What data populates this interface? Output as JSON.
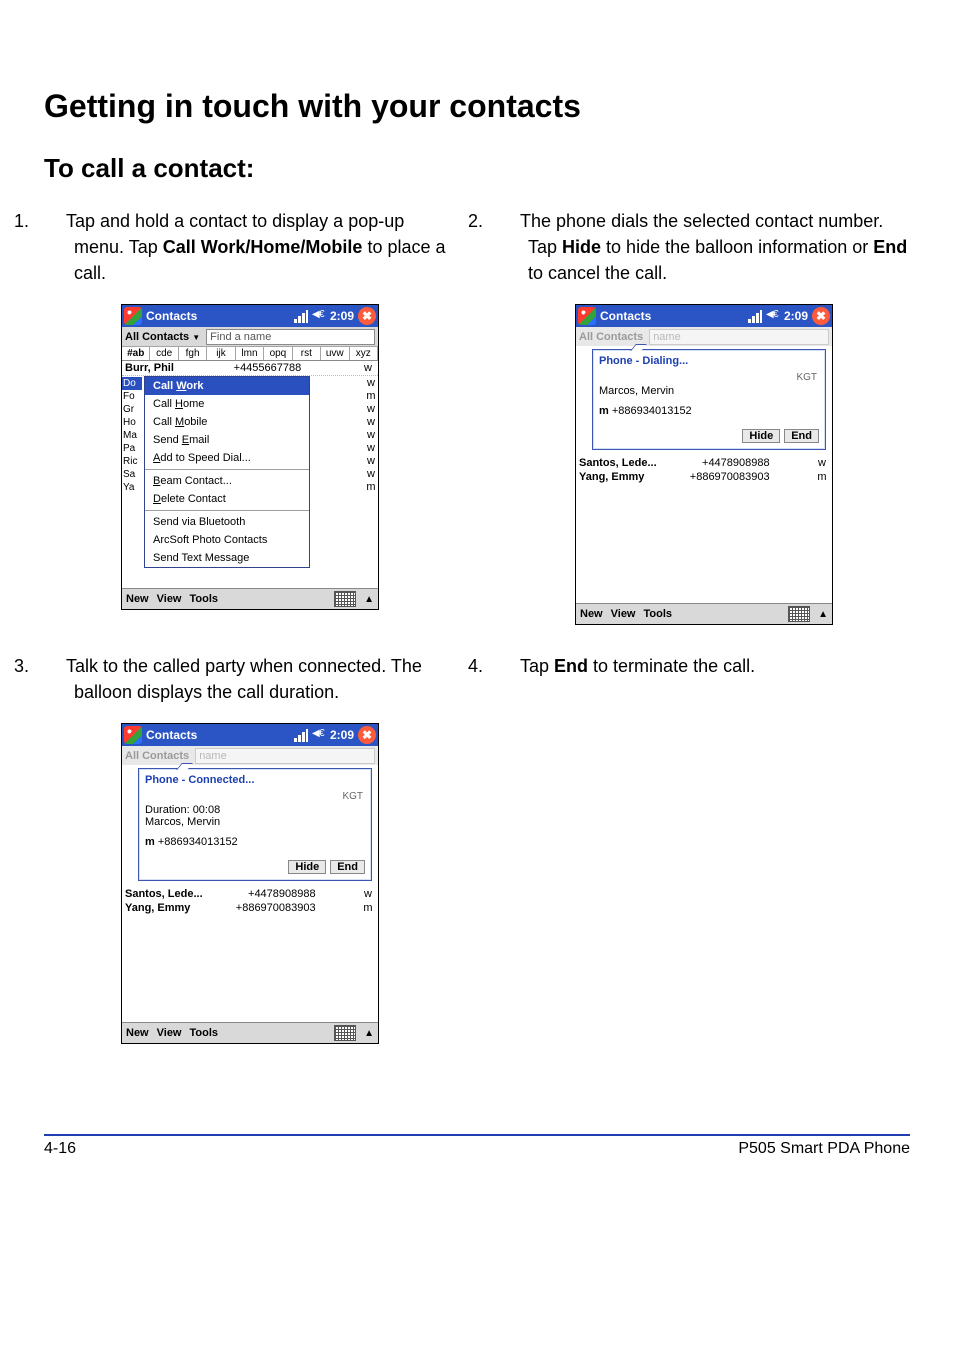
{
  "headings": {
    "section": "Getting in touch with your contacts",
    "sub": "To call a contact:"
  },
  "steps": {
    "s1": {
      "num": "1.",
      "a": "Tap and hold a contact to display a pop-up menu. Tap ",
      "b": "Call Work/Home/Mobile",
      "c": " to place a call."
    },
    "s2": {
      "num": "2.",
      "a": "The phone dials the selected contact number. Tap ",
      "b": "Hide",
      "c": " to hide the balloon information or ",
      "d": "End",
      "e": " to cancel the call."
    },
    "s3": {
      "num": "3.",
      "a": "Talk to the called party when connected. The balloon displays the call duration."
    },
    "s4": {
      "num": "4.",
      "a": "Tap ",
      "b": "End",
      "c": " to terminate the call."
    }
  },
  "titlebar": {
    "app": "Contacts",
    "time": "2:09",
    "close_glyph": "✖"
  },
  "filter": {
    "label": "All Contacts",
    "find_placeholder": "Find a name"
  },
  "alpha": [
    "#ab",
    "cde",
    "fgh",
    "ijk",
    "lmn",
    "opq",
    "rst",
    "uvw",
    "xyz"
  ],
  "shot1": {
    "header_name": "Burr, Phil",
    "header_phone": "+4455667788",
    "header_type": "w",
    "stubs": [
      "Do",
      "Fo",
      "Gr",
      "Ho",
      "Ma",
      "Pa",
      "Ric",
      "Sa",
      "Ya"
    ],
    "rest_types": [
      "w",
      "m",
      "w",
      "w",
      "w",
      "w",
      "w",
      "w",
      "m"
    ],
    "popup": {
      "items": [
        {
          "pre": "Call ",
          "u": "W",
          "post": "ork",
          "sel": true
        },
        {
          "pre": "Call ",
          "u": "H",
          "post": "ome"
        },
        {
          "pre": "Call ",
          "u": "M",
          "post": "obile"
        },
        {
          "pre": "Send ",
          "u": "E",
          "post": "mail"
        },
        {
          "pre": "",
          "u": "A",
          "post": "dd to Speed Dial..."
        },
        {
          "hr": true
        },
        {
          "pre": "",
          "u": "B",
          "post": "eam Contact..."
        },
        {
          "pre": "",
          "u": "D",
          "post": "elete Contact"
        },
        {
          "hr": true
        },
        {
          "plain": "Send via Bluetooth"
        },
        {
          "plain": "ArcSoft Photo Contacts"
        },
        {
          "plain": "Send Text Message"
        }
      ]
    }
  },
  "balloon": {
    "dialing": "Phone - Dialing...",
    "connected": "Phone - Connected...",
    "kgt": "KGT",
    "name": "Marcos, Mervin",
    "num_prefix": "m ",
    "num": "+886934013152",
    "duration": "Duration: 00:08",
    "btn_hide": "Hide",
    "btn_end": "End"
  },
  "list_after": [
    {
      "name": "Santos, Lede...",
      "phone": "+4478908988",
      "type": "w"
    },
    {
      "name": "Yang, Emmy",
      "phone": "+886970083903",
      "type": "m"
    }
  ],
  "softmenu": {
    "new": "New",
    "view": "View",
    "tools": "Tools",
    "up": "▲"
  },
  "footer": {
    "left": "4-16",
    "right": "P505 Smart PDA Phone"
  }
}
